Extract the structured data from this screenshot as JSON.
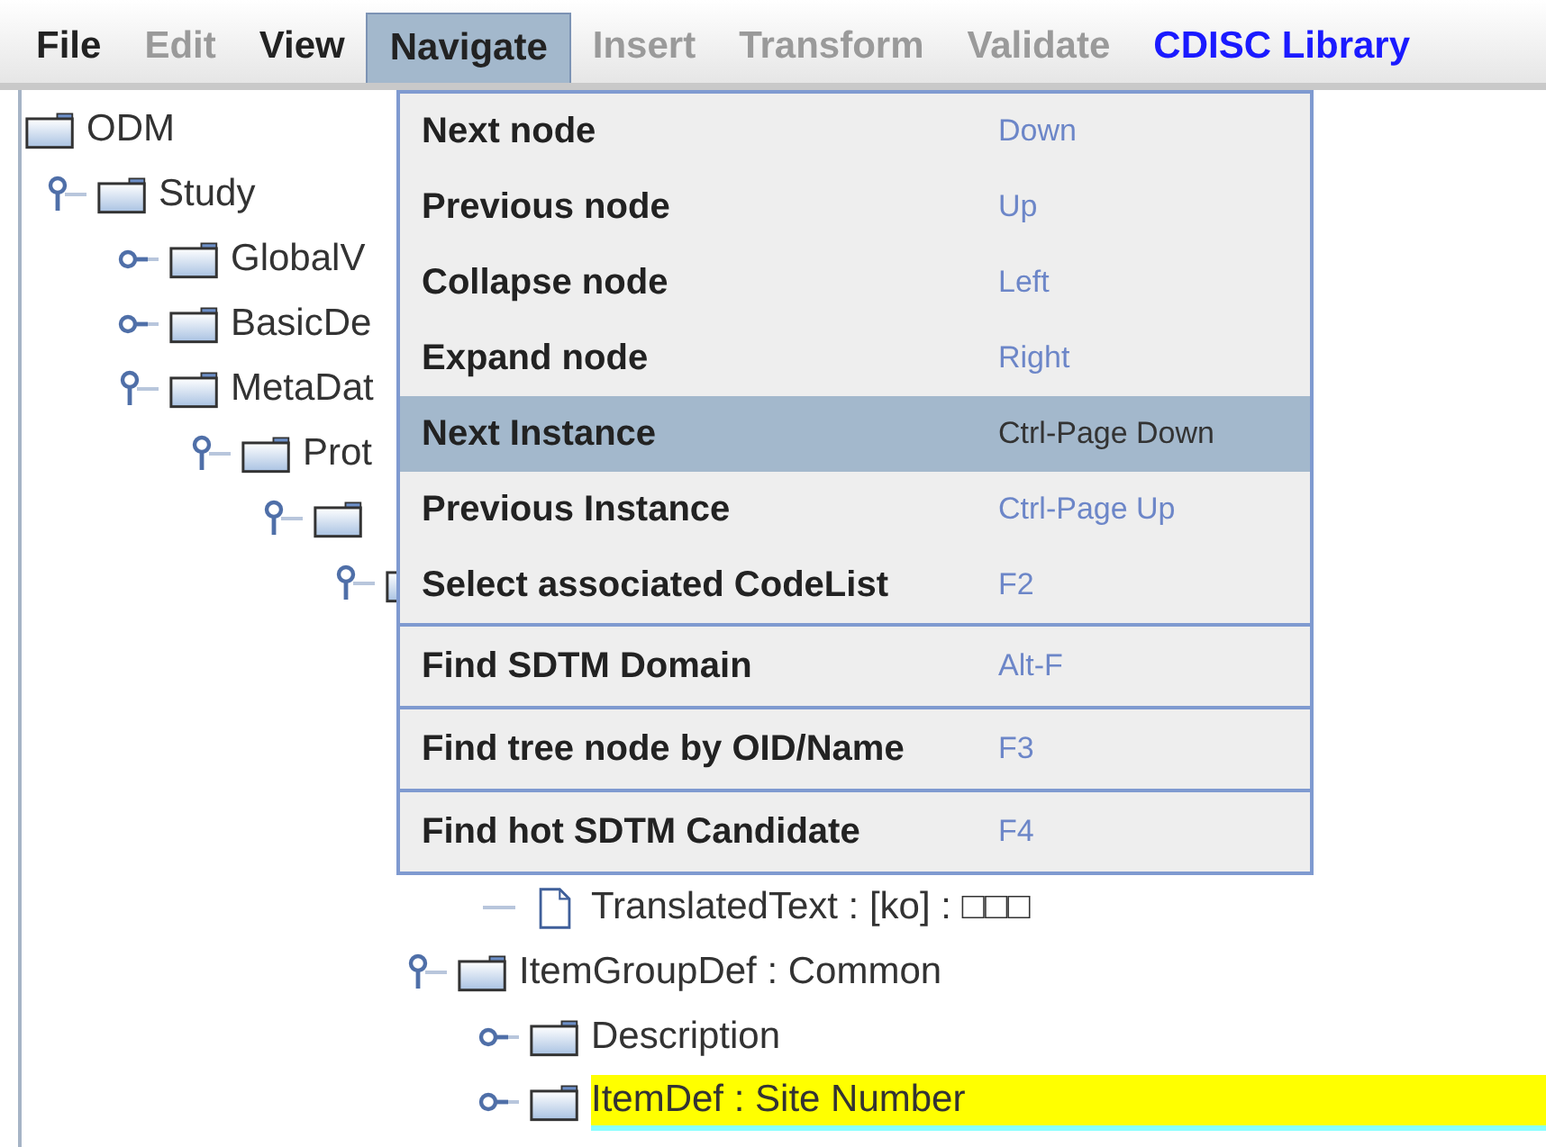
{
  "menubar": [
    {
      "label": "File",
      "disabled": false,
      "selected": false
    },
    {
      "label": "Edit",
      "disabled": true,
      "selected": false
    },
    {
      "label": "View",
      "disabled": false,
      "selected": false
    },
    {
      "label": "Navigate",
      "disabled": false,
      "selected": true
    },
    {
      "label": "Insert",
      "disabled": true,
      "selected": false
    },
    {
      "label": "Transform",
      "disabled": true,
      "selected": false
    },
    {
      "label": "Validate",
      "disabled": true,
      "selected": false
    },
    {
      "label": "CDISC Library",
      "disabled": false,
      "selected": false,
      "color": "#1a1aff"
    }
  ],
  "menu": {
    "groups": [
      [
        {
          "label": "Next node",
          "shortcut": "Down",
          "selected": false
        },
        {
          "label": "Previous node",
          "shortcut": "Up",
          "selected": false
        },
        {
          "label": "Collapse node",
          "shortcut": "Left",
          "selected": false
        },
        {
          "label": "Expand node",
          "shortcut": "Right",
          "selected": false
        },
        {
          "label": "Next Instance",
          "shortcut": "Ctrl-Page Down",
          "selected": true
        },
        {
          "label": "Previous Instance",
          "shortcut": "Ctrl-Page Up",
          "selected": false
        },
        {
          "label": "Select associated CodeList",
          "shortcut": "F2",
          "selected": false
        }
      ],
      [
        {
          "label": "Find SDTM Domain",
          "shortcut": "Alt-F",
          "selected": false
        }
      ],
      [
        {
          "label": "Find tree node by OID/Name",
          "shortcut": "F3",
          "selected": false
        }
      ],
      [
        {
          "label": "Find hot SDTM Candidate",
          "shortcut": "F4",
          "selected": false
        }
      ]
    ]
  },
  "tree": [
    {
      "label": "ODM",
      "kind": "folder",
      "selected": false,
      "children": [
        {
          "label": "Study",
          "kind": "folder",
          "expanded": true,
          "selected": false,
          "children": [
            {
              "label": "GlobalV",
              "kind": "folder",
              "expanded": false,
              "selected": false
            },
            {
              "label": "BasicDe",
              "kind": "folder",
              "expanded": false,
              "selected": false
            },
            {
              "label": "MetaDat",
              "kind": "folder",
              "expanded": true,
              "selected": false,
              "children": [
                {
                  "label": "Prot",
                  "kind": "folder",
                  "expanded": true,
                  "selected": false,
                  "children": [
                    {
                      "kind": "folder",
                      "expanded": true,
                      "selected": false,
                      "children": [
                        {
                          "kind": "folder",
                          "expanded": true,
                          "selected": false,
                          "children": [
                            {
                              "children": [
                                {
                                  "label": "TranslatedText : [ko] : □□□",
                                  "kind": "document",
                                  "selected": false
                                }
                              ]
                            },
                            {
                              "label": "ItemGroupDef : Common",
                              "kind": "folder",
                              "expanded": true,
                              "selected": false,
                              "children": [
                                {
                                  "label": "Description",
                                  "kind": "folder",
                                  "expanded": false,
                                  "selected": false
                                },
                                {
                                  "label": "ItemDef : Site Number",
                                  "kind": "folder",
                                  "expanded": false,
                                  "selected": true
                                }
                              ]
                            }
                          ]
                        }
                      ]
                    }
                  ]
                }
              ]
            }
          ]
        }
      ]
    }
  ]
}
